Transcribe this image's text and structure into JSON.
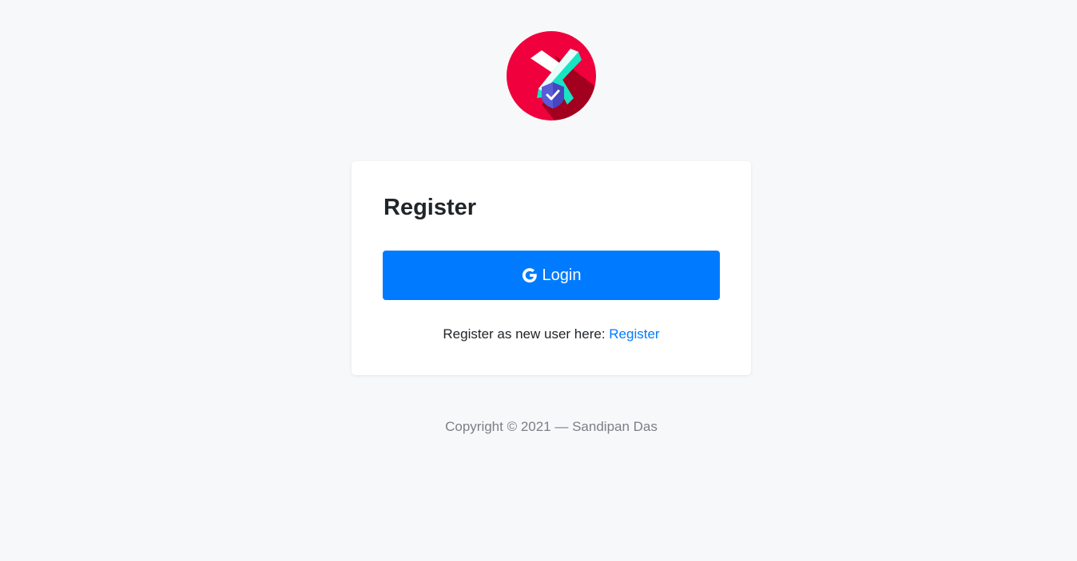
{
  "logo": {
    "icon": "airplane-shield-icon",
    "colors": {
      "circle": "#f0003c",
      "shadow": "#a3001f",
      "plane_white": "#ffffff",
      "plane_teal": "#19e3c3",
      "shield": "#5a5bd6"
    }
  },
  "card": {
    "title": "Register",
    "login_button": {
      "icon": "google-icon",
      "label": "Login",
      "color": "#007bff"
    },
    "register_prompt": {
      "text": "Register as new user here: ",
      "link_label": "Register",
      "link_color": "#007bff"
    }
  },
  "footer": {
    "copyright": "Copyright © 2021 — Sandipan Das"
  }
}
